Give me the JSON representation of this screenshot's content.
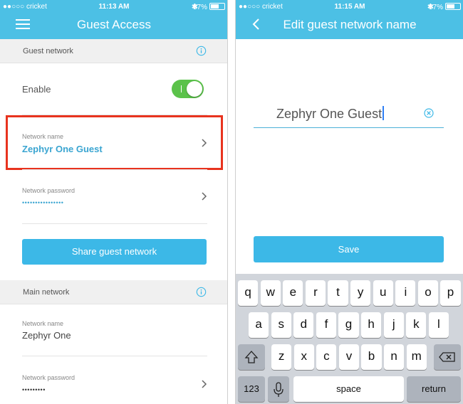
{
  "left": {
    "status": {
      "carrier": "●●○○○ cricket",
      "time": "11:13 AM",
      "battery": "57%",
      "bluetooth": "✱"
    },
    "header": {
      "title": "Guest Access"
    },
    "guest_section": {
      "title": "Guest network"
    },
    "enable": {
      "label": "Enable",
      "on": true
    },
    "guest_network_name": {
      "label": "Network name",
      "value": "Zephyr One Guest"
    },
    "guest_network_password": {
      "label": "Network password",
      "value": "••••••••••••••••"
    },
    "share_button": "Share guest network",
    "main_section": {
      "title": "Main network"
    },
    "main_network_name": {
      "label": "Network name",
      "value": "Zephyr One"
    },
    "main_network_password": {
      "label": "Network password",
      "value": "•••••••••"
    }
  },
  "right": {
    "status": {
      "carrier": "●●○○○ cricket",
      "time": "11:15 AM",
      "battery": "57%",
      "bluetooth": "✱"
    },
    "header": {
      "title": "Edit guest network name"
    },
    "name_input": {
      "value": "Zephyr One Guest"
    },
    "save_button": "Save",
    "keyboard": {
      "row1": [
        "q",
        "w",
        "e",
        "r",
        "t",
        "y",
        "u",
        "i",
        "o",
        "p"
      ],
      "row2": [
        "a",
        "s",
        "d",
        "f",
        "g",
        "h",
        "j",
        "k",
        "l"
      ],
      "row3": [
        "z",
        "x",
        "c",
        "v",
        "b",
        "n",
        "m"
      ],
      "numbers_key": "123",
      "space_key": "space",
      "return_key": "return"
    }
  },
  "colors": {
    "accent": "#4cc0e5",
    "button": "#3cb8e7",
    "toggle_on": "#5bc24a",
    "highlight": "#e8331e"
  },
  "icons": [
    "menu-icon",
    "info-icon",
    "chevron-right-icon",
    "back-chevron-icon",
    "clear-icon",
    "shift-icon",
    "delete-icon",
    "mic-icon",
    "wifi-icon",
    "bluetooth-icon",
    "battery-icon"
  ]
}
